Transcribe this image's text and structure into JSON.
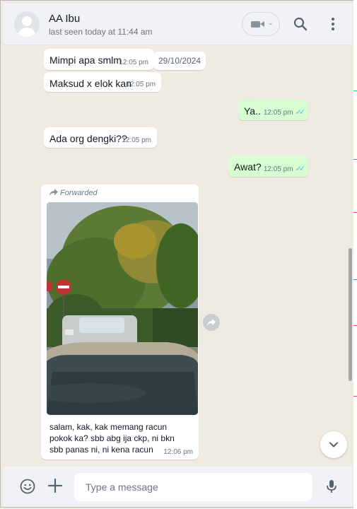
{
  "header": {
    "contact_name": "AA Ibu",
    "last_seen": "last seen today at 11:44 am"
  },
  "date_chip": "29/10/2024",
  "messages": [
    {
      "dir": "in",
      "text": "Mimpi apa smlm",
      "time": "12:05 pm"
    },
    {
      "dir": "in",
      "text": "Maksud x elok kan",
      "time": "12:05 pm"
    },
    {
      "dir": "out",
      "text": "Ya..",
      "time": "12:05 pm",
      "ticks": "✓✓"
    },
    {
      "dir": "in",
      "text": "Ada org dengki??",
      "time": "12:05 pm"
    },
    {
      "dir": "out",
      "text": "Awat?",
      "time": "12:05 pm",
      "ticks": "✓✓"
    }
  ],
  "forwarded_message": {
    "label": "Forwarded",
    "caption": "salam, kak, kak memang racun\npokok ka? sbb abg ija ckp, ni bkn\nsbb panas ni, ni kena racun",
    "time": "12:06 pm"
  },
  "footer": {
    "placeholder": "Type a message"
  },
  "icons": [
    "avatar",
    "video-call-icon",
    "chevron-down-icon",
    "search-icon",
    "menu-icon",
    "forward-icon",
    "share-icon",
    "scroll-down-icon",
    "emoji-icon",
    "plus-icon",
    "mic-icon"
  ],
  "colors": {
    "incoming": "#ffffff",
    "outgoing": "#d9fdd3",
    "chat_bg": "#efeae2",
    "header_bg": "#f0f2f5",
    "read_ticks": "#53bdeb"
  }
}
